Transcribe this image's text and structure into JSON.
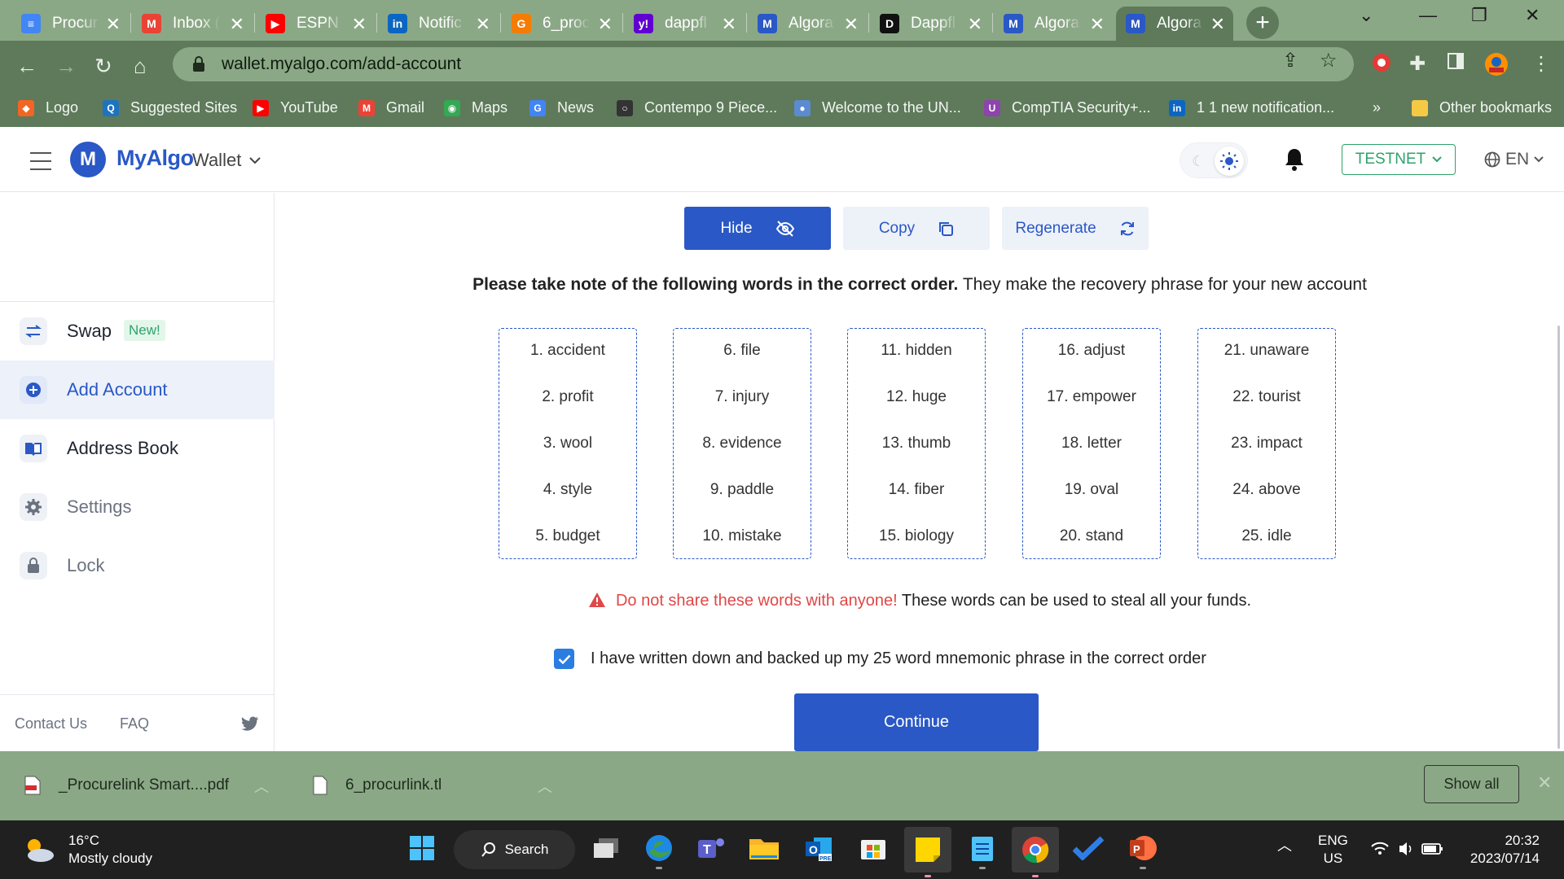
{
  "browser": {
    "tabs": [
      {
        "title": "Procur",
        "icon": "docs-icon",
        "color": "#4285f4",
        "glyph": "≡"
      },
      {
        "title": "Inbox (",
        "icon": "gmail-icon",
        "color": "#ea4335",
        "glyph": "M"
      },
      {
        "title": "ESPN F",
        "icon": "youtube-icon",
        "color": "#ff0000",
        "glyph": "▶"
      },
      {
        "title": "Notific",
        "icon": "linkedin-icon",
        "color": "#0a66c2",
        "glyph": "in"
      },
      {
        "title": "6_proc",
        "icon": "gitlab-icon",
        "color": "#f57c00",
        "glyph": "G"
      },
      {
        "title": "dappfl",
        "icon": "yahoo-icon",
        "color": "#6001d2",
        "glyph": "y!"
      },
      {
        "title": "Algora",
        "icon": "myalgo-icon",
        "color": "#2a58c7",
        "glyph": "M"
      },
      {
        "title": "Dappfl",
        "icon": "dappflow-icon",
        "color": "#111111",
        "glyph": "D"
      },
      {
        "title": "Algora",
        "icon": "myalgo-icon",
        "color": "#2a58c7",
        "glyph": "M"
      },
      {
        "title": "Algora",
        "icon": "myalgo-icon",
        "color": "#2a58c7",
        "glyph": "M"
      }
    ],
    "url": "wallet.myalgo.com/add-account",
    "bookmarks": [
      {
        "label": "Logo",
        "color": "#f26522",
        "glyph": "◆"
      },
      {
        "label": "Suggested Sites",
        "color": "#1e73be",
        "glyph": "Q"
      },
      {
        "label": "YouTube",
        "color": "#ff0000",
        "glyph": "▶"
      },
      {
        "label": "Gmail",
        "color": "#ea4335",
        "glyph": "M"
      },
      {
        "label": "Maps",
        "color": "#34a853",
        "glyph": "◉"
      },
      {
        "label": "News",
        "color": "#4285f4",
        "glyph": "G"
      },
      {
        "label": "Contempo 9 Piece...",
        "color": "#333333",
        "glyph": "○"
      },
      {
        "label": "Welcome to the UN...",
        "color": "#5b8bd0",
        "glyph": "●"
      },
      {
        "label": "CompTIA Security+...",
        "color": "#8e44ad",
        "glyph": "U"
      },
      {
        "label": "1 1 new notification...",
        "color": "#0a66c2",
        "glyph": "in"
      }
    ],
    "bookmarks_overflow": "»",
    "other_bookmarks": "Other bookmarks"
  },
  "header": {
    "brand": "MyAlgo",
    "wallet_menu": "Wallet",
    "network": "TESTNET",
    "language": "EN"
  },
  "sidebar": {
    "items": [
      {
        "label": "Swap",
        "badge": "New!",
        "icon": "swap-icon"
      },
      {
        "label": "Add Account",
        "icon": "plus-circle-icon"
      },
      {
        "label": "Address Book",
        "icon": "book-icon"
      },
      {
        "label": "Settings",
        "icon": "gear-icon"
      },
      {
        "label": "Lock",
        "icon": "lock-icon"
      }
    ],
    "footer": {
      "contact": "Contact Us",
      "faq": "FAQ",
      "social": "twitter-icon"
    }
  },
  "main": {
    "buttons": {
      "hide": "Hide",
      "copy": "Copy",
      "regenerate": "Regenerate"
    },
    "instruction_bold": "Please take note of the following words in the correct order.",
    "instruction_rest": " They make the recovery phrase for your new account",
    "mnemonic_columns": [
      [
        "1. accident",
        "2. profit",
        "3. wool",
        "4. style",
        "5. budget"
      ],
      [
        "6. file",
        "7. injury",
        "8. evidence",
        "9. paddle",
        "10. mistake"
      ],
      [
        "11. hidden",
        "12. huge",
        "13. thumb",
        "14. fiber",
        "15. biology"
      ],
      [
        "16. adjust",
        "17. empower",
        "18. letter",
        "19. oval",
        "20. stand"
      ],
      [
        "21. unaware",
        "22. tourist",
        "23. impact",
        "24. above",
        "25. idle"
      ]
    ],
    "warning_red": "Do not share these words with anyone!",
    "warning_rest": " These words can be used to steal all your funds.",
    "confirm_checked": true,
    "confirm_label": "I have written down and backed up my 25 word mnemonic phrase in the correct order",
    "continue": "Continue"
  },
  "downloads": {
    "items": [
      {
        "name": "_Procurelink Smart....pdf",
        "icon": "pdf-icon"
      },
      {
        "name": "6_procurlink.tl",
        "icon": "file-icon"
      }
    ],
    "show_all": "Show all"
  },
  "taskbar": {
    "weather_temp": "16°C",
    "weather_desc": "Mostly cloudy",
    "search": "Search",
    "lang_top": "ENG",
    "lang_bottom": "US",
    "time": "20:32",
    "date": "2023/07/14"
  },
  "colors": {
    "brand_blue": "#2a58c7",
    "testnet_green": "#2ea36b",
    "warning_red": "#e04747",
    "chrome_frame": "#8ba886",
    "chrome_toolbar": "#5e7a5b"
  }
}
